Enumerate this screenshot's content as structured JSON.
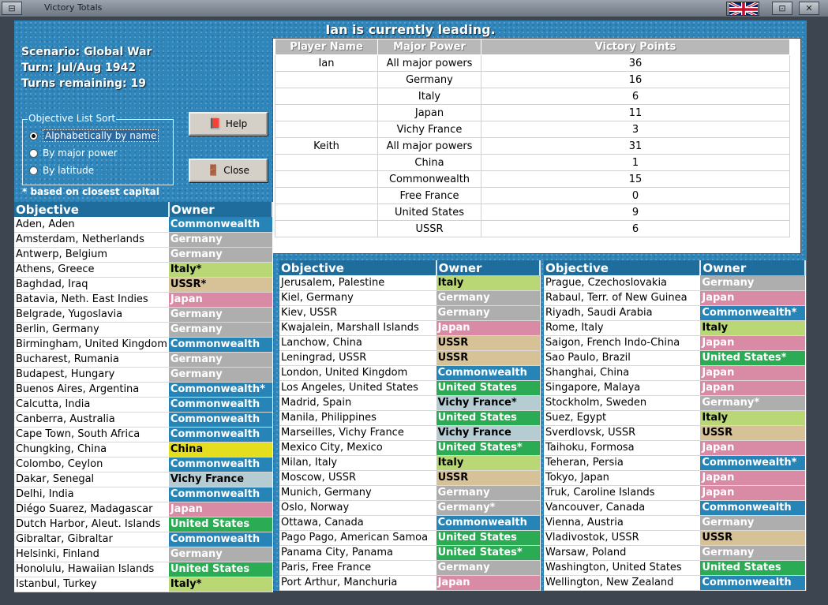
{
  "window": {
    "title": "Victory Totals",
    "left_button": "⊟",
    "right_button": "✕",
    "right_button2": "⊡"
  },
  "banner": "Ian is currently leading.",
  "scenario": {
    "line1": "Scenario: Global War",
    "line2": "Turn: Jul/Aug 1942",
    "line3": "Turns remaining: 19"
  },
  "sort": {
    "legend": "Objective List Sort",
    "options": [
      "Alphabetically by name",
      "By major power",
      "By latitude"
    ],
    "selected": 0
  },
  "buttons": {
    "help": "Help",
    "close": "Close"
  },
  "note": "* based on closest capital",
  "victory": {
    "headers": [
      "Player Name",
      "Major Power",
      "Victory Points"
    ],
    "rows": [
      [
        "Ian",
        "All major powers",
        "36"
      ],
      [
        "",
        "Germany",
        "16"
      ],
      [
        "",
        "Italy",
        "6"
      ],
      [
        "",
        "Japan",
        "11"
      ],
      [
        "",
        "Vichy France",
        "3"
      ],
      [
        "Keith",
        "All major powers",
        "31"
      ],
      [
        "",
        "China",
        "1"
      ],
      [
        "",
        "Commonwealth",
        "15"
      ],
      [
        "",
        "Free France",
        "0"
      ],
      [
        "",
        "United States",
        "9"
      ],
      [
        "",
        "USSR",
        "6"
      ]
    ]
  },
  "objective_headers": {
    "objective": "Objective",
    "owner": "Owner"
  },
  "col1": [
    [
      "Aden, Aden",
      "Commonwealth"
    ],
    [
      "Amsterdam, Netherlands",
      "Germany"
    ],
    [
      "Antwerp, Belgium",
      "Germany"
    ],
    [
      "Athens, Greece",
      "Italy*"
    ],
    [
      "Baghdad, Iraq",
      "USSR*"
    ],
    [
      "Batavia, Neth. East Indies",
      "Japan"
    ],
    [
      "Belgrade, Yugoslavia",
      "Germany"
    ],
    [
      "Berlin, Germany",
      "Germany"
    ],
    [
      "Birmingham, United Kingdom",
      "Commonwealth"
    ],
    [
      "Bucharest, Rumania",
      "Germany"
    ],
    [
      "Budapest, Hungary",
      "Germany"
    ],
    [
      "Buenos Aires, Argentina",
      "Commonwealth*"
    ],
    [
      "Calcutta, India",
      "Commonwealth"
    ],
    [
      "Canberra, Australia",
      "Commonwealth"
    ],
    [
      "Cape Town, South Africa",
      "Commonwealth"
    ],
    [
      "Chungking, China",
      "China"
    ],
    [
      "Colombo, Ceylon",
      "Commonwealth"
    ],
    [
      "Dakar, Senegal",
      "Vichy France"
    ],
    [
      "Delhi, India",
      "Commonwealth"
    ],
    [
      "Diégo Suarez, Madagascar",
      "Japan"
    ],
    [
      "Dutch Harbor, Aleut. Islands",
      "United States"
    ],
    [
      "Gibraltar, Gibraltar",
      "Commonwealth"
    ],
    [
      "Helsinki, Finland",
      "Germany"
    ],
    [
      "Honolulu, Hawaiian Islands",
      "United States"
    ],
    [
      "Istanbul, Turkey",
      "Italy*"
    ]
  ],
  "col2": [
    [
      "Jerusalem, Palestine",
      "Italy"
    ],
    [
      "Kiel, Germany",
      "Germany"
    ],
    [
      "Kiev, USSR",
      "Germany"
    ],
    [
      "Kwajalein, Marshall Islands",
      "Japan"
    ],
    [
      "Lanchow, China",
      "USSR"
    ],
    [
      "Leningrad, USSR",
      "USSR"
    ],
    [
      "London, United Kingdom",
      "Commonwealth"
    ],
    [
      "Los Angeles, United States",
      "United States"
    ],
    [
      "Madrid, Spain",
      "Vichy France*"
    ],
    [
      "Manila, Philippines",
      "United States"
    ],
    [
      "Marseilles, Vichy France",
      "Vichy France"
    ],
    [
      "Mexico City, Mexico",
      "United States*"
    ],
    [
      "Milan, Italy",
      "Italy"
    ],
    [
      "Moscow, USSR",
      "USSR"
    ],
    [
      "Munich, Germany",
      "Germany"
    ],
    [
      "Oslo, Norway",
      "Germany*"
    ],
    [
      "Ottawa, Canada",
      "Commonwealth"
    ],
    [
      "Pago Pago, American Samoa",
      "United States"
    ],
    [
      "Panama City, Panama",
      "United States*"
    ],
    [
      "Paris, Free France",
      "Germany"
    ],
    [
      "Port Arthur, Manchuria",
      "Japan"
    ]
  ],
  "col3": [
    [
      "Prague, Czechoslovakia",
      "Germany"
    ],
    [
      "Rabaul, Terr. of New Guinea",
      "Japan"
    ],
    [
      "Riyadh, Saudi Arabia",
      "Commonwealth*"
    ],
    [
      "Rome, Italy",
      "Italy"
    ],
    [
      "Saigon, French Indo-China",
      "Japan"
    ],
    [
      "Sao Paulo, Brazil",
      "United States*"
    ],
    [
      "Shanghai, China",
      "Japan"
    ],
    [
      "Singapore, Malaya",
      "Japan"
    ],
    [
      "Stockholm, Sweden",
      "Germany*"
    ],
    [
      "Suez, Egypt",
      "Italy"
    ],
    [
      "Sverdlovsk, USSR",
      "USSR"
    ],
    [
      "Taihoku, Formosa",
      "Japan"
    ],
    [
      "Teheran, Persia",
      "Commonwealth*"
    ],
    [
      "Tokyo, Japan",
      "Japan"
    ],
    [
      "Truk, Caroline Islands",
      "Japan"
    ],
    [
      "Vancouver, Canada",
      "Commonwealth"
    ],
    [
      "Vienna, Austria",
      "Germany"
    ],
    [
      "Vladivostok, USSR",
      "USSR"
    ],
    [
      "Warsaw, Poland",
      "Germany"
    ],
    [
      "Washington, United States",
      "United States"
    ],
    [
      "Wellington, New Zealand",
      "Commonwealth"
    ]
  ],
  "owner_colors": {
    "Commonwealth": "#2784b6",
    "Germany": "#aeaeae",
    "Italy": "#b9d775",
    "USSR": "#d7c197",
    "Japan": "#d98ba6",
    "China": "#e4de1f",
    "Vichy France": "#b5ccd3",
    "United States": "#2cab55"
  },
  "icons": {
    "help": "book-icon",
    "close": "exit-door-icon",
    "flag": "union-jack-flag-icon"
  }
}
